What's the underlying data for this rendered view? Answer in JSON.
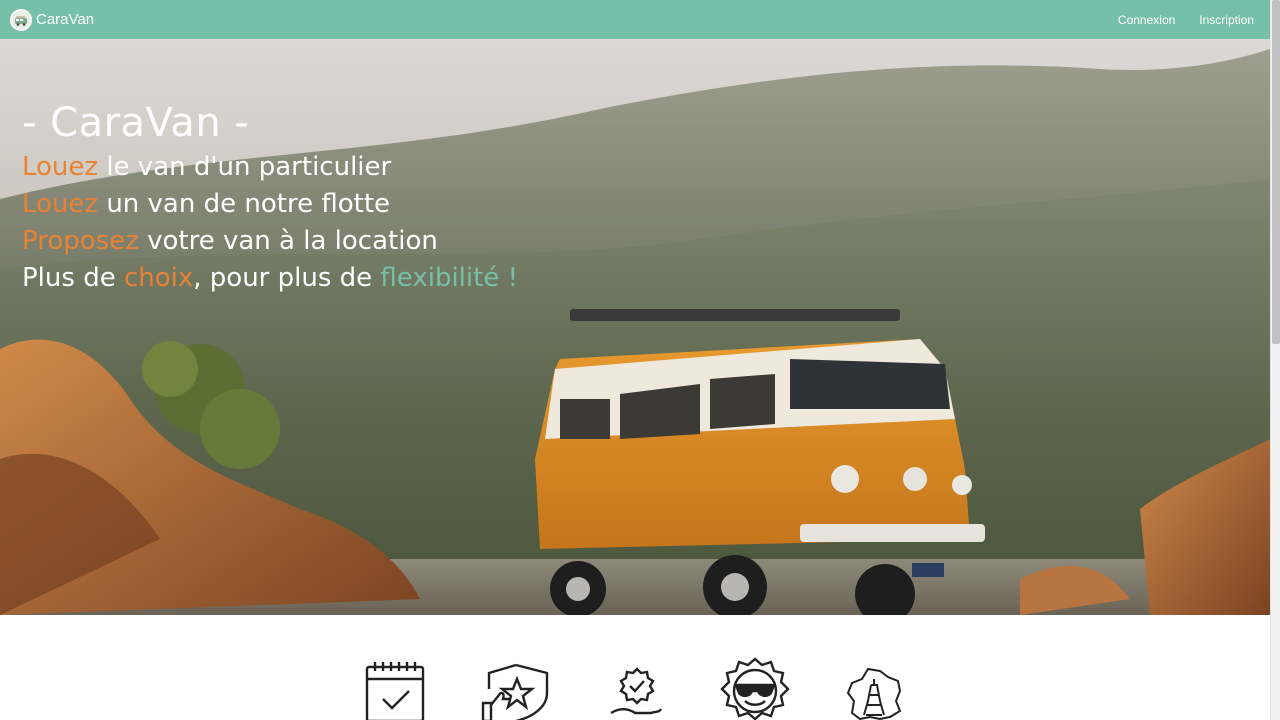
{
  "brand": {
    "name": "CaraVan",
    "logo_icon": "van-logo-icon"
  },
  "nav": {
    "login": "Connexion",
    "signup": "Inscription"
  },
  "hero": {
    "title": "- CaraVan -",
    "line1": {
      "highlight": "Louez",
      "rest": " le van d'un particulier"
    },
    "line2": {
      "highlight": "Louez",
      "rest": " un van de notre flotte"
    },
    "line3": {
      "highlight": "Proposez",
      "rest": " votre van à la location"
    },
    "line4": {
      "part1": "Plus de ",
      "highlight1": "choix",
      "part2": ", pour plus de ",
      "highlight2": "flexibilité !"
    }
  },
  "features": {
    "icons": [
      "calendar-check-icon",
      "shield-star-thumb-icon",
      "badge-hand-icon",
      "sun-sunglasses-icon",
      "france-eiffel-icon"
    ]
  },
  "colors": {
    "brand": "#76bfa9",
    "accent": "#e88234",
    "text_light": "#ffffff"
  }
}
